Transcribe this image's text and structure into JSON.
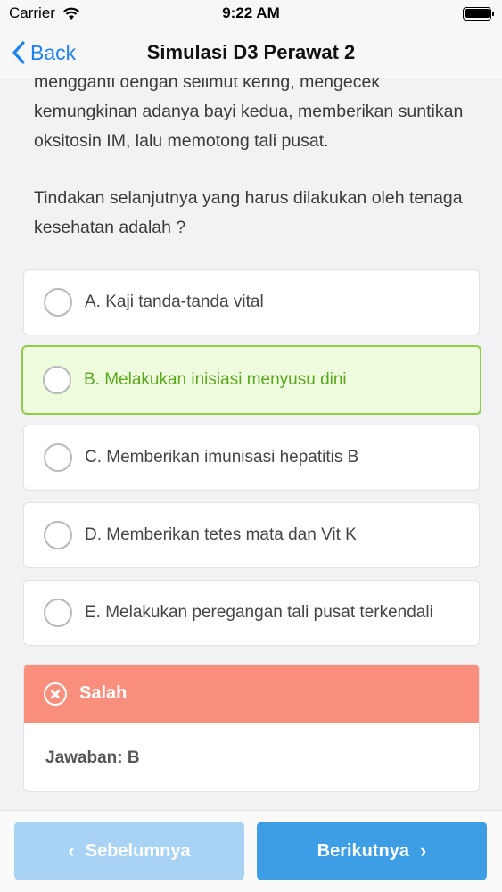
{
  "status_bar": {
    "carrier": "Carrier",
    "time": "9:22 AM"
  },
  "nav": {
    "back_label": "Back",
    "title": "Simulasi D3 Perawat 2"
  },
  "question": {
    "text_part1": "mengganti dengan selimut kering, mengecek kemungkinan adanya bayi kedua, memberikan suntikan oksitosin IM, lalu memotong tali pusat.",
    "text_part2": "Tindakan selanjutnya yang harus dilakukan oleh tenaga kesehatan adalah ?"
  },
  "options": [
    {
      "label": "A. Kaji tanda-tanda vital",
      "state": "normal"
    },
    {
      "label": "B. Melakukan inisiasi menyusu dini",
      "state": "correct"
    },
    {
      "label": "C. Memberikan imunisasi hepatitis B",
      "state": "normal"
    },
    {
      "label": "D. Memberikan tetes mata dan Vit K",
      "state": "normal"
    },
    {
      "label": "E. Melakukan peregangan tali pusat terkendali",
      "state": "normal"
    }
  ],
  "result": {
    "status": "Salah",
    "answer": "Jawaban: B"
  },
  "footer": {
    "prev_label": "Sebelumnya",
    "next_label": "Berikutnya"
  },
  "colors": {
    "accent_blue": "#1f82f0",
    "correct_green": "#8fcc4a",
    "wrong_red": "#fb8f7d",
    "next_button": "#3d9ee6",
    "prev_button": "#a8d3f4"
  }
}
